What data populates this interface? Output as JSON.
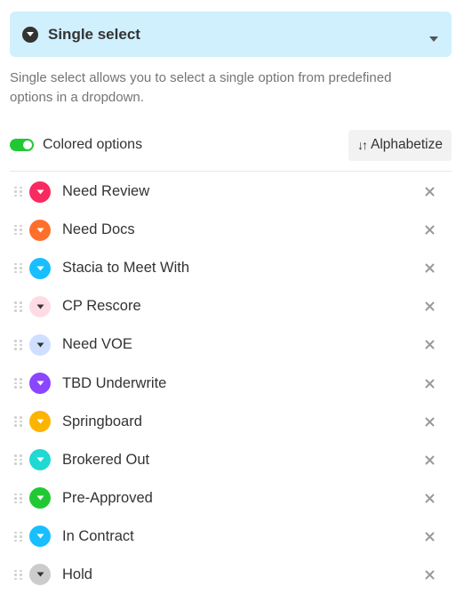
{
  "field_type": {
    "label": "Single select",
    "icon": "chevron-circle-icon",
    "background": "#d0f0fd"
  },
  "description": "Single select allows you to select a single option from predefined options in a dropdown.",
  "options_bar": {
    "colored_options_label": "Colored options",
    "colored_options_enabled": true,
    "alphabetize_label": "Alphabetize"
  },
  "choices": [
    {
      "name": "Need Review",
      "color": "#f82b60",
      "arrow": "#ffffff"
    },
    {
      "name": "Need Docs",
      "color": "#ff6f2c",
      "arrow": "#ffffff"
    },
    {
      "name": "Stacia to Meet With",
      "color": "#18bfff",
      "arrow": "#ffffff"
    },
    {
      "name": "CP Rescore",
      "color": "#ffdce5",
      "arrow": "#333333"
    },
    {
      "name": "Need VOE",
      "color": "#cfdfff",
      "arrow": "#333333"
    },
    {
      "name": "TBD Underwrite",
      "color": "#8b46ff",
      "arrow": "#ffffff"
    },
    {
      "name": "Springboard",
      "color": "#fcb400",
      "arrow": "#ffffff"
    },
    {
      "name": "Brokered Out",
      "color": "#20d9d2",
      "arrow": "#ffffff"
    },
    {
      "name": "Pre-Approved",
      "color": "#20c933",
      "arrow": "#ffffff"
    },
    {
      "name": "In Contract",
      "color": "#18bfff",
      "arrow": "#ffffff"
    },
    {
      "name": "Hold",
      "color": "#cccccc",
      "arrow": "#333333"
    }
  ]
}
